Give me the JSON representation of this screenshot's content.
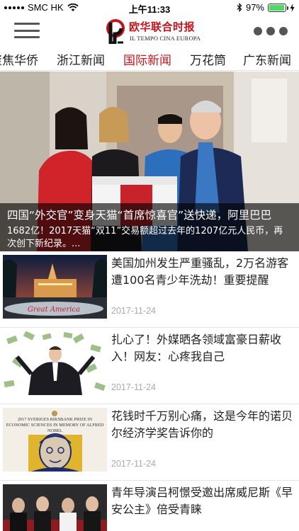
{
  "status_bar": {
    "carrier": "SMC HK",
    "time": "上午11:33",
    "battery_percent": "97%",
    "battery_level": 0.97
  },
  "header": {
    "logo_cn": "欧华联合时报",
    "logo_en": "IL TEMPO CINA EUROPA",
    "menu_icon": "hamburger-icon",
    "more_icon": "more-dots-icon"
  },
  "tabs": [
    {
      "label": "聚焦华侨",
      "active": false
    },
    {
      "label": "浙江新闻",
      "active": false
    },
    {
      "label": "国际新闻",
      "active": true
    },
    {
      "label": "万花筒",
      "active": false
    },
    {
      "label": "广东新闻",
      "active": false
    }
  ],
  "hero": {
    "title": "四国“外交官”变身天猫“首席惊喜官”送快递，阿里巴巴",
    "summary": "1682亿！2017天猫“双11”交易额超过去年的1207亿元人民币，再次创下新纪录。..."
  },
  "articles": [
    {
      "title": "美国加州发生严重骚乱，2万名游客遭100名青少年洗劫！重要提醒",
      "date": "2017-11-24",
      "thumb": "theme-park-photo"
    },
    {
      "title": "扎心了！外媒晒各领域富豪日薪收入！网友：心疼我自己",
      "date": "2017-11-24",
      "thumb": "money-rain-photo"
    },
    {
      "title": "花钱时千万别心痛，这是今年的诺贝尔经济学奖告诉你的",
      "date": "2017-11-24",
      "thumb": "nobel-prize-poster"
    },
    {
      "title": "青年导演吕柯憬受邀出席威尼斯《早安公主》倍受青睐",
      "date": "",
      "thumb": "red-carpet-photo"
    }
  ],
  "thumb_texts": {
    "park_sign": "Great America",
    "nobel_header": "2017 SVERIGES RIKSBANK PRIZE IN ECONOMIC SCIENCES IN MEMORY OF ALFRED NOBEL"
  },
  "colors": {
    "accent": "#c4151c",
    "battery": "#4cd964",
    "date_gray": "#aaaaaa"
  }
}
